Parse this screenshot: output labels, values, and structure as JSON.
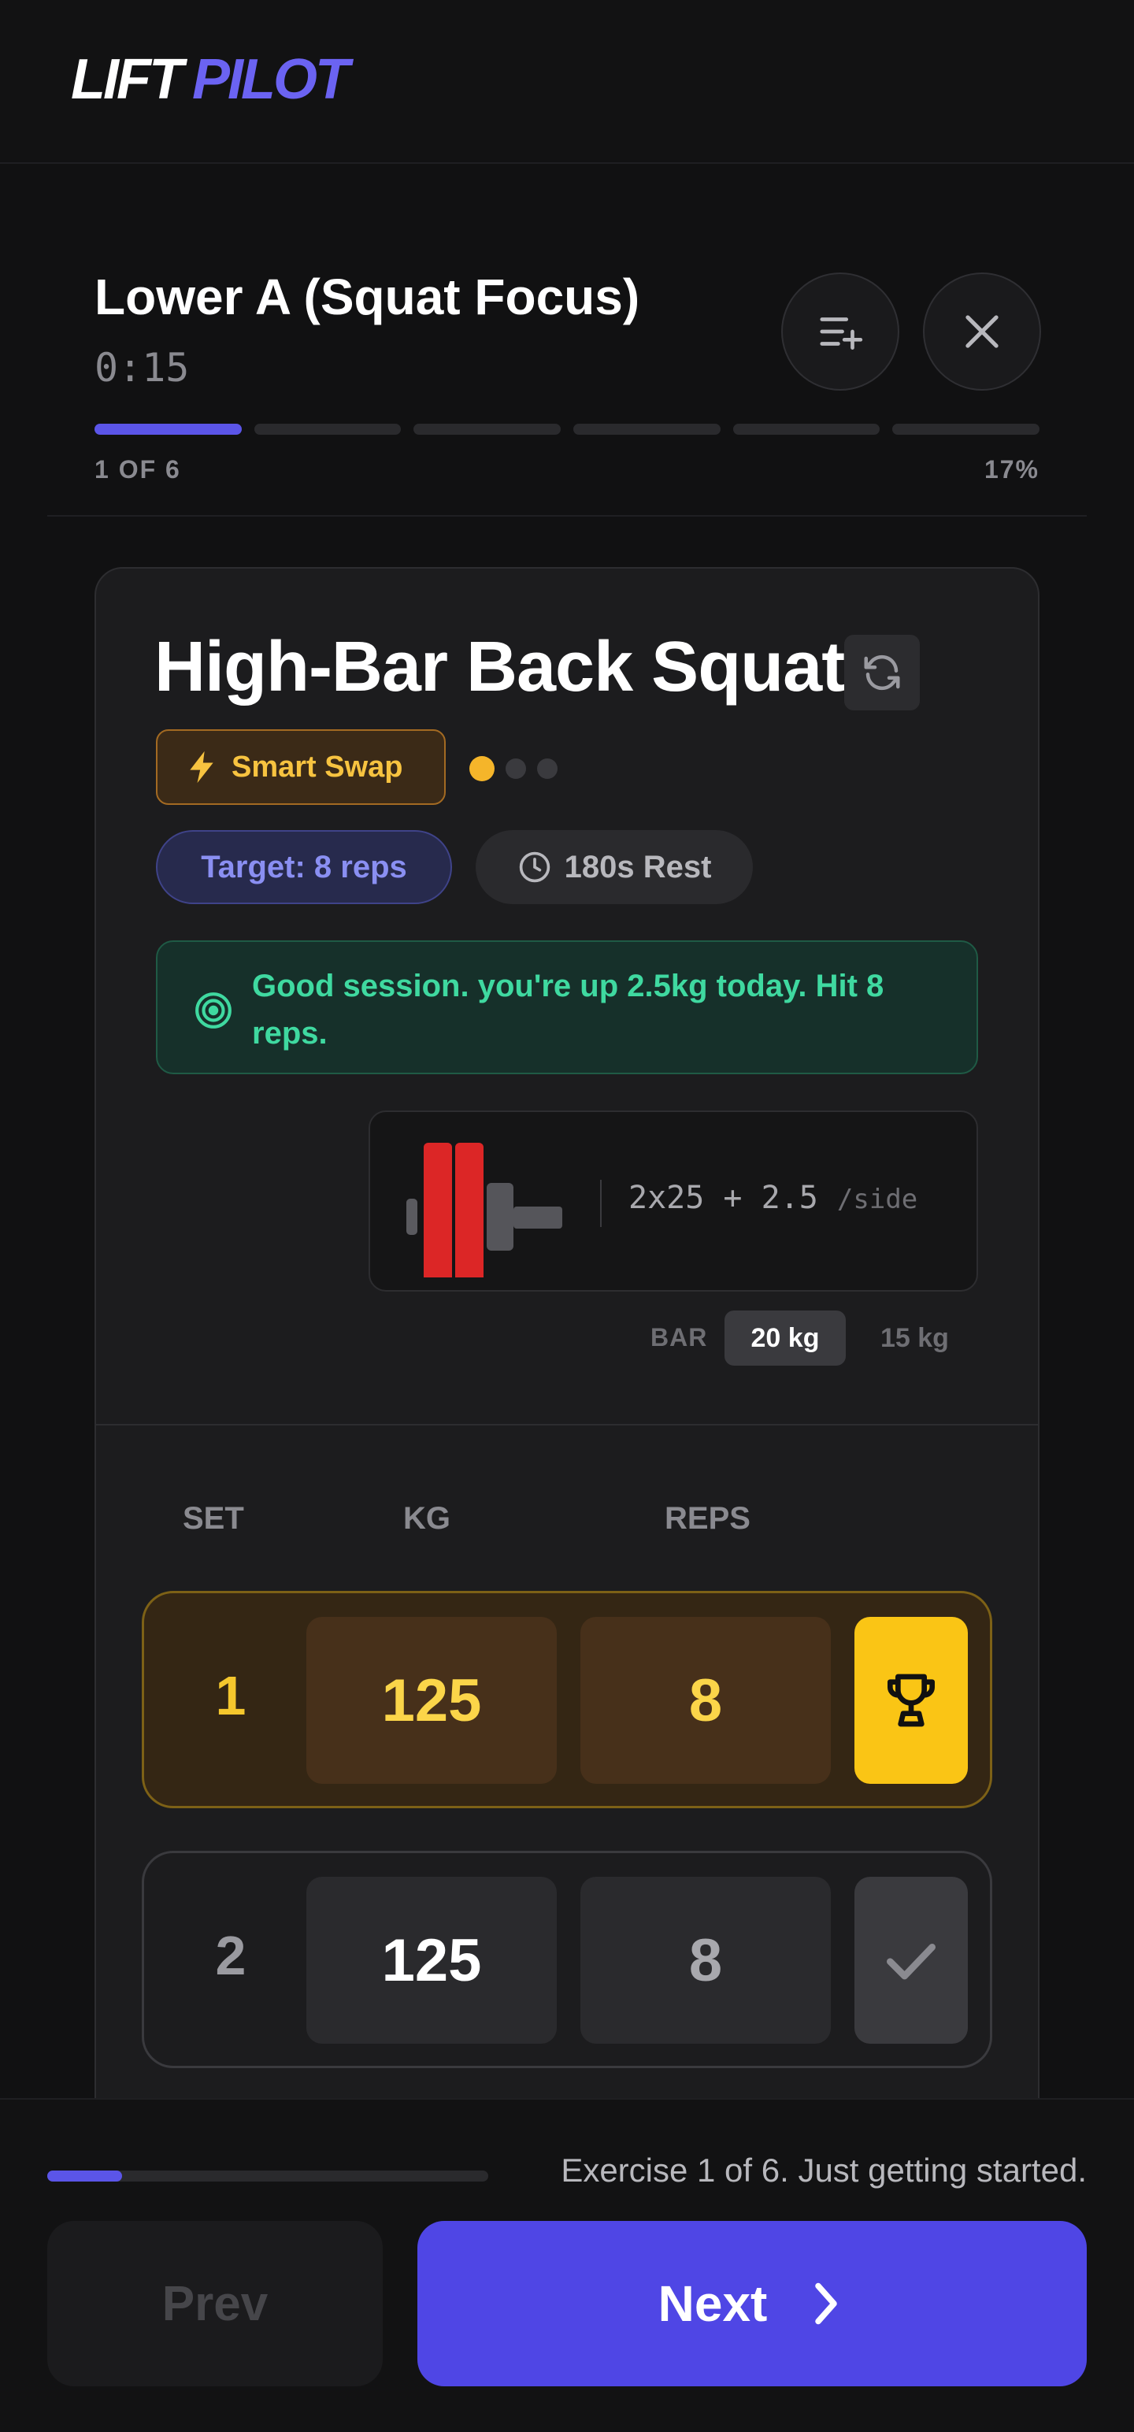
{
  "brand": {
    "word1": "LIFT",
    "word2": "PILOT"
  },
  "workout": {
    "title": "Lower A (Squat Focus)",
    "timer": "0:15",
    "progress_label": "1 OF 6",
    "progress_percent": "17%",
    "segments_total": 6,
    "segments_done": 1
  },
  "exercise": {
    "title": "High-Bar Back Squat",
    "smart_swap_label": "Smart Swap",
    "target_label": "Target: 8 reps",
    "rest_label": "180s Rest",
    "coach_message": "Good session. you're up 2.5kg today. Hit 8 reps.",
    "plates_text": "2x25 + 2.5",
    "plates_unit": "/side",
    "bar_label": "BAR",
    "bar_selected": "20 kg",
    "bar_other": "15 kg"
  },
  "sets_table": {
    "headers": {
      "set": "SET",
      "kg": "KG",
      "reps": "REPS"
    },
    "rows": [
      {
        "set": "1",
        "kg": "125",
        "reps": "8",
        "state": "pr"
      },
      {
        "set": "2",
        "kg": "125",
        "reps": "8",
        "state": "pending"
      }
    ]
  },
  "footer": {
    "status": "Exercise 1 of 6. Just getting started.",
    "progress_fraction": 0.17,
    "prev_label": "Prev",
    "next_label": "Next"
  },
  "colors": {
    "accent": "#4f46e5",
    "highlight_gold": "#fac515",
    "coach_green": "#3fd9a0"
  }
}
